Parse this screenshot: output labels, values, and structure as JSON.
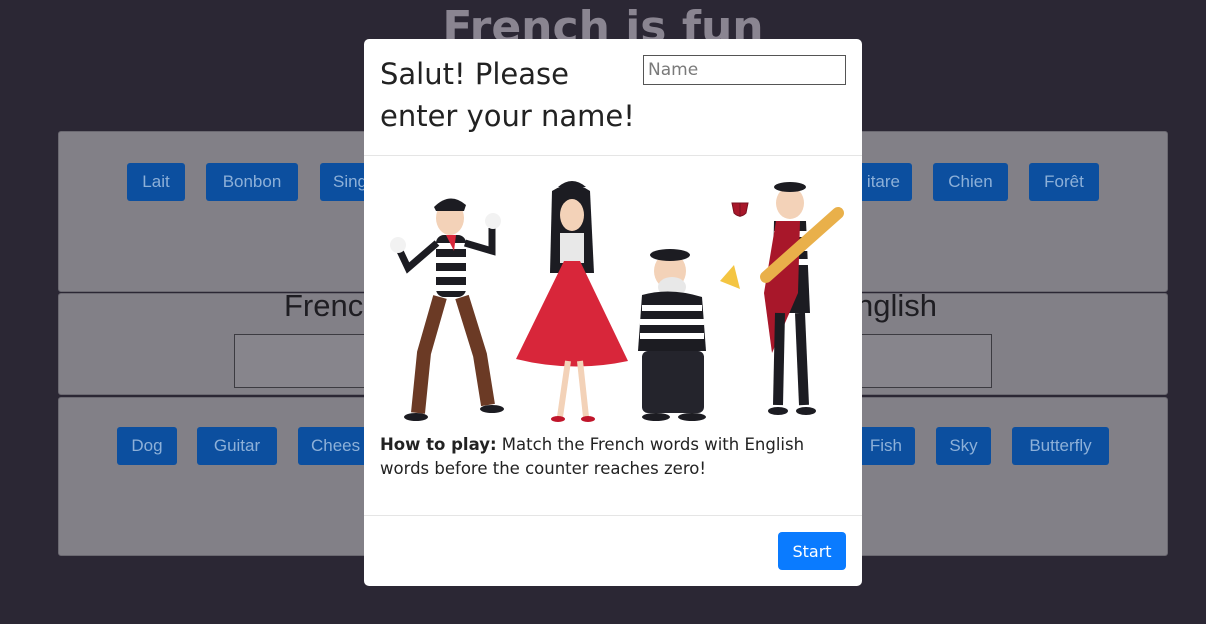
{
  "page": {
    "title": "French is fun"
  },
  "french_words": [
    "Lait",
    "Bonbon",
    "Sing",
    "itare",
    "Chien",
    "Forêt"
  ],
  "column_labels": {
    "french": "Frenc",
    "english": "nglish"
  },
  "english_words": [
    "Dog",
    "Guitar",
    "Chees",
    "Fish",
    "Sky",
    "Butterfly"
  ],
  "modal": {
    "title": "Salut! Please enter your name!",
    "name_placeholder": "Name",
    "name_value": "",
    "howto_label": "How to play:",
    "howto_text": " Match the French words with English words before the counter reaches zero!",
    "start_label": "Start"
  },
  "colors": {
    "backdrop": "#2b2734",
    "word_button": "#0c4f9f",
    "start_button": "#0a7bff"
  }
}
